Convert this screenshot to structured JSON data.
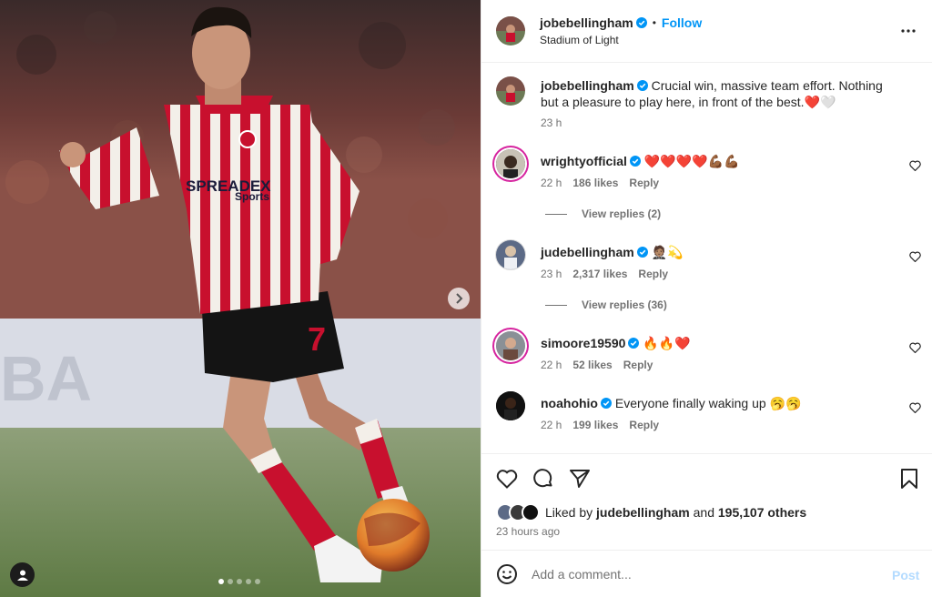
{
  "post": {
    "author": "jobebellingham",
    "follow_label": "Follow",
    "separator": "•",
    "location": "Stadium of Light",
    "caption": "Crucial win, massive team effort. Nothing but a pleasure to play here, in front of the best.❤️🤍",
    "caption_time": "23 h",
    "jersey_sponsor_1": "SPREADEX",
    "jersey_sponsor_2": "Sports",
    "shirt_number": "7"
  },
  "comments": [
    {
      "user": "wrightyofficial",
      "text": "❤️❤️❤️❤️💪🏾💪🏾",
      "time": "22 h",
      "likes": "186 likes",
      "reply": "Reply",
      "view_replies": "View replies (2)",
      "avatar_color": "#3b3b3b"
    },
    {
      "user": "judebellingham",
      "text": "🤵🏽💫",
      "time": "23 h",
      "likes": "2,317 likes",
      "reply": "Reply",
      "view_replies": "View replies (36)",
      "avatar_color": "#8a8f9a"
    },
    {
      "user": "simoore19590",
      "text": "🔥🔥❤️",
      "time": "22 h",
      "likes": "52 likes",
      "reply": "Reply",
      "avatar_color": "#6b4a3e"
    },
    {
      "user": "noahohio",
      "text": "Everyone finally waking up 🥱🥱",
      "time": "22 h",
      "likes": "199 likes",
      "reply": "Reply",
      "avatar_color": "#1a1a1a"
    }
  ],
  "likes_summary": {
    "prefix": "Liked by ",
    "liker": "judebellingham",
    "middle": " and ",
    "count": "195,107 others"
  },
  "time_ago": "23 hours ago",
  "composer": {
    "placeholder": "Add a comment...",
    "post_label": "Post"
  },
  "icons": {
    "verified": "verified-badge-icon",
    "more": "more-horizontal-icon",
    "like": "heart-icon",
    "comment": "comment-icon",
    "share": "paper-plane-icon",
    "save": "bookmark-icon",
    "emoji": "smiley-icon",
    "next": "chevron-right-icon",
    "tags": "user-tag-icon"
  },
  "colors": {
    "accent": "#0095f6",
    "verified": "#0095f6",
    "post_disabled": "#b3dbff",
    "jersey_red": "#c8102e"
  }
}
